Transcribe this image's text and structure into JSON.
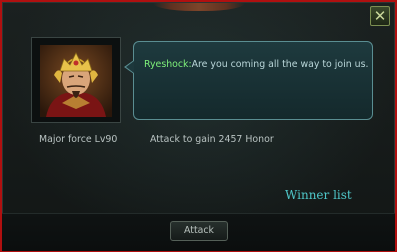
{
  "dialog": {
    "close_label": "✕"
  },
  "opponent": {
    "speaker": "Ryeshock:",
    "message": "Are you coming all the way to join us.",
    "level_text": "Major force Lv90",
    "honor_text": "Attack to gain 2457 Honor"
  },
  "links": {
    "winner_list": "Winner list"
  },
  "actions": {
    "attack_label": "Attack"
  },
  "colors": {
    "frame_border": "#b01010",
    "speaker_name": "#7ef07a",
    "link": "#4fc7c9",
    "bubble_border": "#5a8e92"
  }
}
